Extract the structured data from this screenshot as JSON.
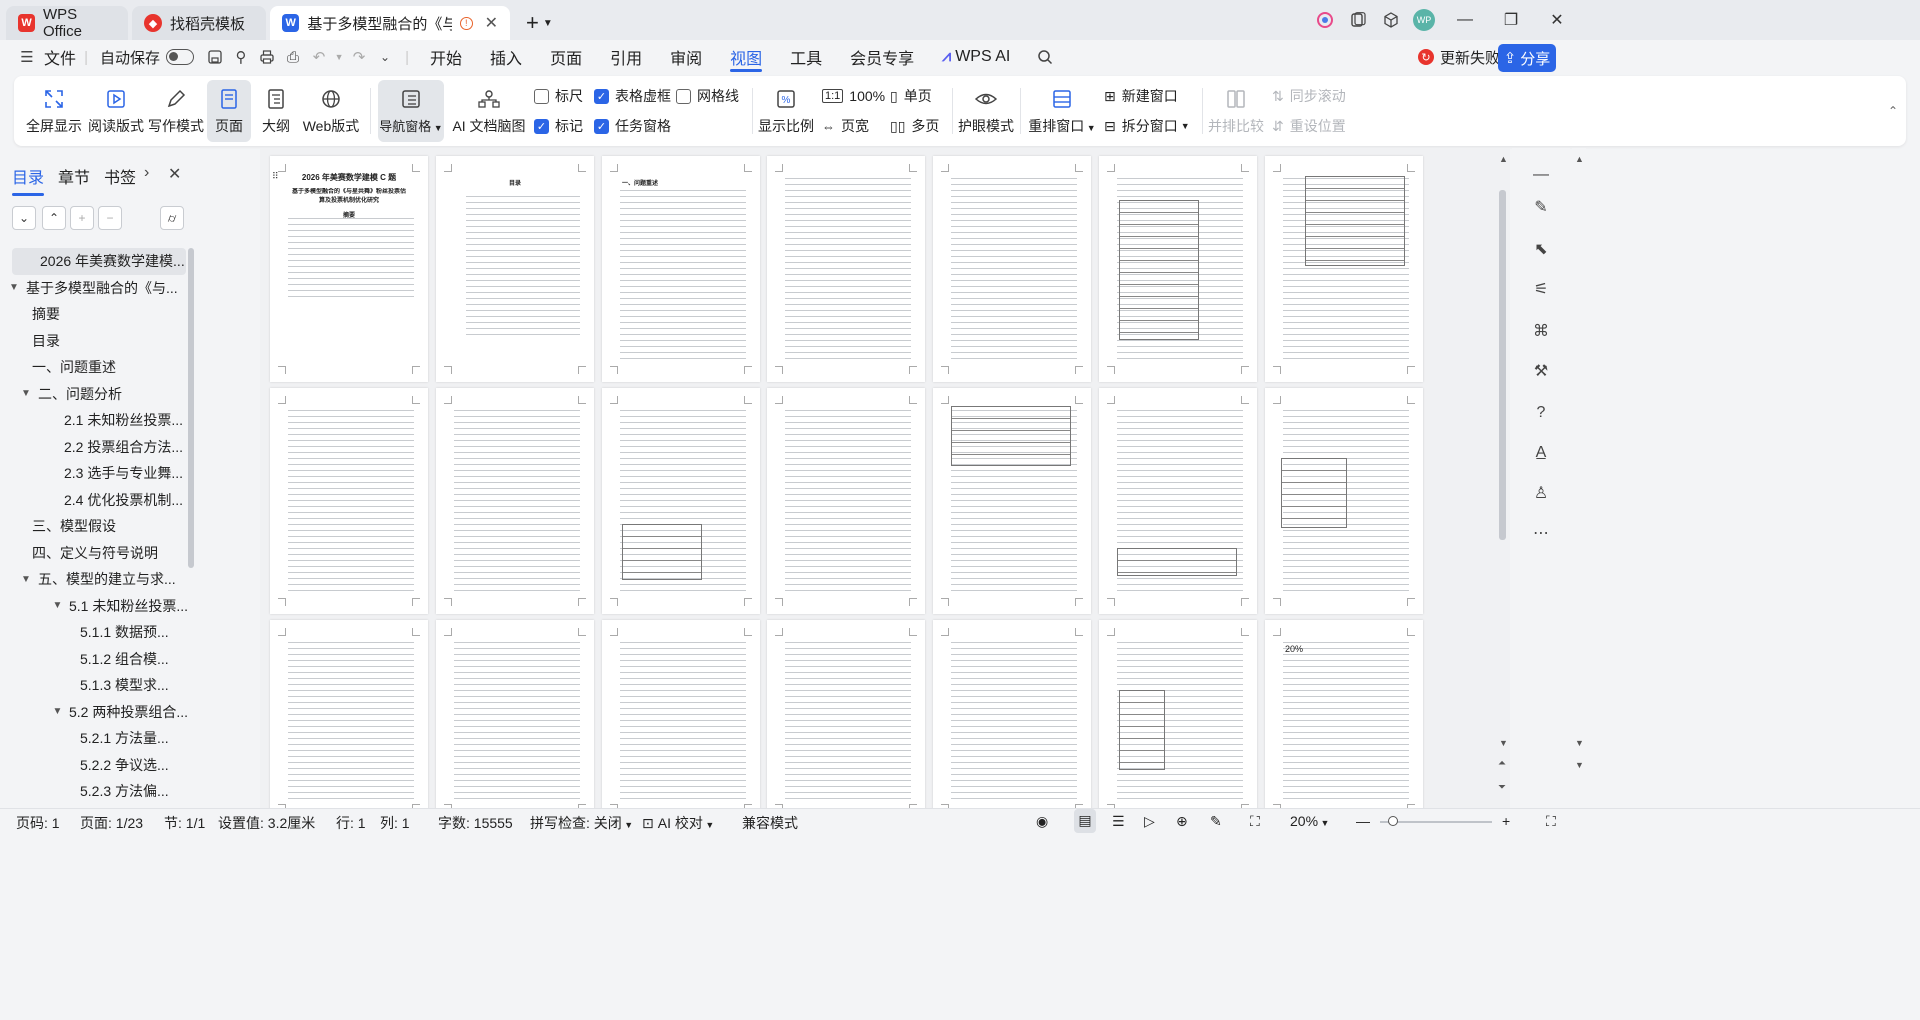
{
  "tabs": [
    {
      "label": "WPS Office",
      "icon": "wps-logo-icon"
    },
    {
      "label": "找稻壳模板",
      "icon": "docer-icon"
    },
    {
      "label": "基于多模型融合的《与星共舞",
      "icon": "writer-doc-icon"
    }
  ],
  "user_avatar": "WP",
  "menu": {
    "file_label": "文件",
    "autosave_label": "自动保存",
    "items": [
      "开始",
      "插入",
      "页面",
      "引用",
      "审阅",
      "视图",
      "工具",
      "会员专享",
      "WPS AI"
    ],
    "active_item": "视图",
    "update_fail_label": "更新失败",
    "share_label": "分享"
  },
  "ribbon": {
    "buttons": [
      "全屏显示",
      "阅读版式",
      "写作模式",
      "页面",
      "大纲",
      "Web版式",
      "导航窗格",
      "AI 文档脑图"
    ],
    "checks": [
      {
        "label": "标尺",
        "checked": false
      },
      {
        "label": "表格虚框",
        "checked": true
      },
      {
        "label": "网格线",
        "checked": false
      },
      {
        "label": "标记",
        "checked": true
      },
      {
        "label": "任务窗格",
        "checked": true
      }
    ],
    "zoom_label": "显示比例",
    "zoom_100": "100%",
    "page_width": "页宽",
    "single_page": "单页",
    "multi_page": "多页",
    "eye_mode": "护眼模式",
    "rearrange": "重排窗口",
    "new_window": "新建窗口",
    "split_window": "拆分窗口",
    "side_by_side": "并排比较",
    "sync_scroll": "同步滚动",
    "reset_pos": "重设位置"
  },
  "leftpanel": {
    "tabs": [
      "目录",
      "章节",
      "书签"
    ],
    "toc": [
      {
        "label": "2026 年美赛数学建模...",
        "level": 0,
        "arrow": "",
        "selected": true
      },
      {
        "label": "基于多模型融合的《与...",
        "level": 0,
        "arrow": "▼"
      },
      {
        "label": "摘要",
        "level": 1,
        "arrow": ""
      },
      {
        "label": "目录",
        "level": 1,
        "arrow": ""
      },
      {
        "label": "一、问题重述",
        "level": 1,
        "arrow": ""
      },
      {
        "label": "二、问题分析",
        "level": 1,
        "arrow": "▼"
      },
      {
        "label": "2.1 未知粉丝投票...",
        "level": 2,
        "arrow": ""
      },
      {
        "label": "2.2 投票组合方法...",
        "level": 2,
        "arrow": ""
      },
      {
        "label": "2.3 选手与专业舞...",
        "level": 2,
        "arrow": ""
      },
      {
        "label": "2.4 优化投票机制...",
        "level": 2,
        "arrow": ""
      },
      {
        "label": "三、模型假设",
        "level": 1,
        "arrow": ""
      },
      {
        "label": "四、定义与符号说明",
        "level": 1,
        "arrow": ""
      },
      {
        "label": "五、模型的建立与求...",
        "level": 1,
        "arrow": "▼"
      },
      {
        "label": "5.1 未知粉丝投票...",
        "level": 2,
        "arrow": "▼"
      },
      {
        "label": "5.1.1 数据预...",
        "level": 3,
        "arrow": ""
      },
      {
        "label": "5.1.2 组合模...",
        "level": 3,
        "arrow": ""
      },
      {
        "label": "5.1.3 模型求...",
        "level": 3,
        "arrow": ""
      },
      {
        "label": "5.2 两种投票组合...",
        "level": 2,
        "arrow": "▼"
      },
      {
        "label": "5.2.1 方法量...",
        "level": 3,
        "arrow": ""
      },
      {
        "label": "5.2.2 争议选...",
        "level": 3,
        "arrow": ""
      },
      {
        "label": "5.2.3 方法偏...",
        "level": 3,
        "arrow": ""
      }
    ]
  },
  "document": {
    "page1_title": "2026 年美赛数学建模 C 题",
    "page1_subtitle": "基于多模型融合的《与星共舞》粉丝投票估算及投票机制优化研究",
    "page1_heading": "摘要",
    "page2_heading": "目录",
    "page3_heading": "一、问题重述",
    "p30_text": "20%"
  },
  "status": {
    "page_no": "页码: 1",
    "pages": "页面: 1/23",
    "section": "节: 1/1",
    "setting": "设置值: 3.2厘米",
    "row": "行: 1",
    "col": "列: 1",
    "words": "字数: 15555",
    "spell": "拼写检查: 关闭",
    "ai_check": "AI 校对",
    "compat": "兼容模式",
    "zoom": "20%"
  },
  "colors": {
    "accent": "#2b65e6",
    "wps_red": "#e8342d"
  }
}
